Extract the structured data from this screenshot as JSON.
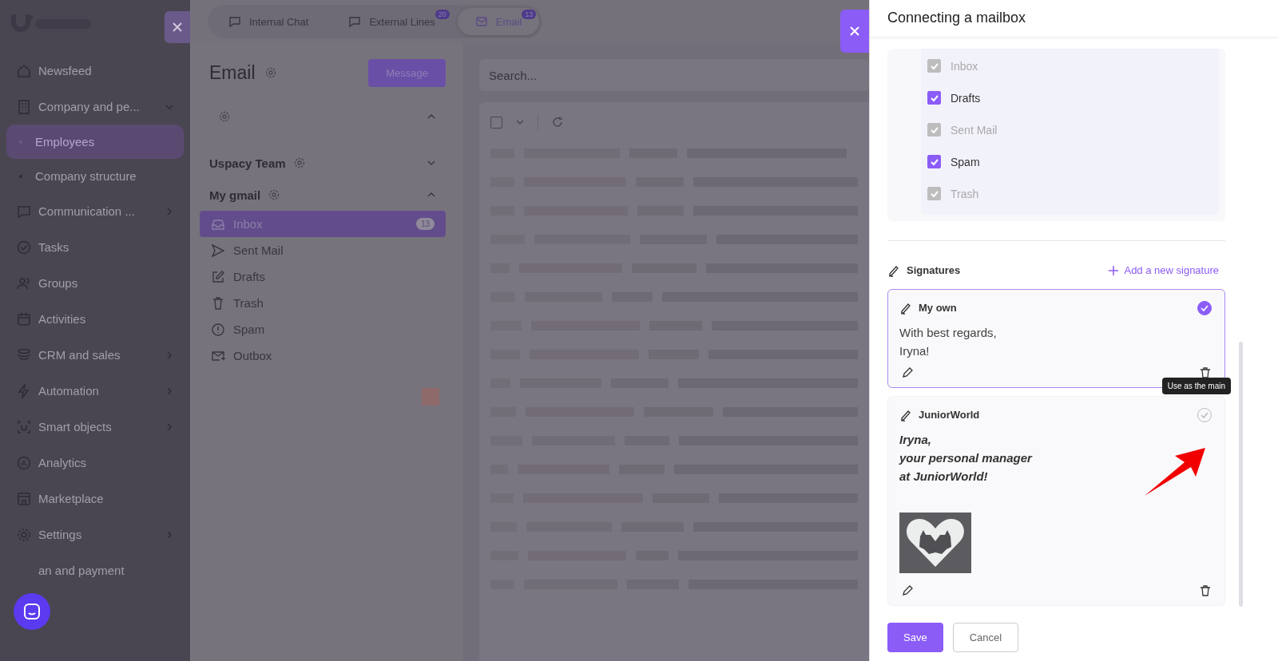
{
  "sidebar": {
    "items": [
      {
        "label": "Newsfeed",
        "kind": "item",
        "selected": false,
        "has_children": false
      },
      {
        "label": "Company and pe...",
        "kind": "item",
        "selected": false,
        "has_children": true,
        "expanded": true
      },
      {
        "label": "Employees",
        "kind": "subitem",
        "selected": true,
        "has_children": false
      },
      {
        "label": "Company structure",
        "kind": "subitem",
        "selected": false,
        "has_children": false
      },
      {
        "label": "Communication ...",
        "kind": "item",
        "selected": false,
        "has_children": true,
        "expanded": false
      },
      {
        "label": "Tasks",
        "kind": "item",
        "selected": false,
        "has_children": false
      },
      {
        "label": "Groups",
        "kind": "item",
        "selected": false,
        "has_children": false
      },
      {
        "label": "Activities",
        "kind": "item",
        "selected": false,
        "has_children": false
      },
      {
        "label": "CRM and sales",
        "kind": "item",
        "selected": false,
        "has_children": true,
        "expanded": false
      },
      {
        "label": "Automation",
        "kind": "item",
        "selected": false,
        "has_children": true,
        "expanded": false
      },
      {
        "label": "Smart objects",
        "kind": "item",
        "selected": false,
        "has_children": true,
        "expanded": false
      },
      {
        "label": "Analytics",
        "kind": "item",
        "selected": false,
        "has_children": false
      },
      {
        "label": "Marketplace",
        "kind": "item",
        "selected": false,
        "has_children": false
      },
      {
        "label": "Settings",
        "kind": "item",
        "selected": false,
        "has_children": true,
        "expanded": false
      },
      {
        "label": "an and payment",
        "kind": "item",
        "selected": false,
        "has_children": false
      }
    ]
  },
  "tabs": [
    {
      "label": "Internal Chat",
      "selected": false
    },
    {
      "label": "External Lines",
      "badge": "20",
      "selected": false
    },
    {
      "label": "Email",
      "badge": "13",
      "selected": true
    }
  ],
  "email": {
    "title": "Email",
    "message_button": "Message",
    "groups": [
      {
        "expanded": true
      },
      {
        "name": "Uspacy Team",
        "expanded": false
      },
      {
        "name": "My gmail",
        "expanded": true,
        "folders": [
          {
            "label": "Inbox",
            "count": "13",
            "selected": true
          },
          {
            "label": "Sent Mail",
            "selected": false
          },
          {
            "label": "Drafts",
            "selected": false
          },
          {
            "label": "Trash",
            "selected": false
          },
          {
            "label": "Spam",
            "selected": false
          },
          {
            "label": "Outbox",
            "selected": false
          }
        ]
      }
    ]
  },
  "search": {
    "placeholder": "Search..."
  },
  "select_all": {
    "checked": false
  },
  "drawer": {
    "title": "Connecting a mailbox",
    "folders": [
      {
        "label": "Inbox",
        "checked": true,
        "disabled": true
      },
      {
        "label": "Drafts",
        "checked": true,
        "disabled": false
      },
      {
        "label": "Sent Mail",
        "checked": true,
        "disabled": true
      },
      {
        "label": "Spam",
        "checked": true,
        "disabled": false
      },
      {
        "label": "Trash",
        "checked": true,
        "disabled": true
      }
    ],
    "signatures_heading": "Signatures",
    "add_signature": "Add a new signature",
    "signatures": [
      {
        "name": "My own",
        "kind": "plain",
        "lines": [
          "With best regards,",
          "Iryna!"
        ],
        "main": true,
        "image": false
      },
      {
        "name": "JuniorWorld",
        "kind": "styled",
        "lines": [
          "Iryna,",
          "your personal manager",
          "at JuniorWorld!"
        ],
        "main": false,
        "image": true,
        "tooltip": "Use as the main"
      }
    ],
    "buttons": {
      "save": "Save",
      "cancel": "Cancel"
    }
  }
}
